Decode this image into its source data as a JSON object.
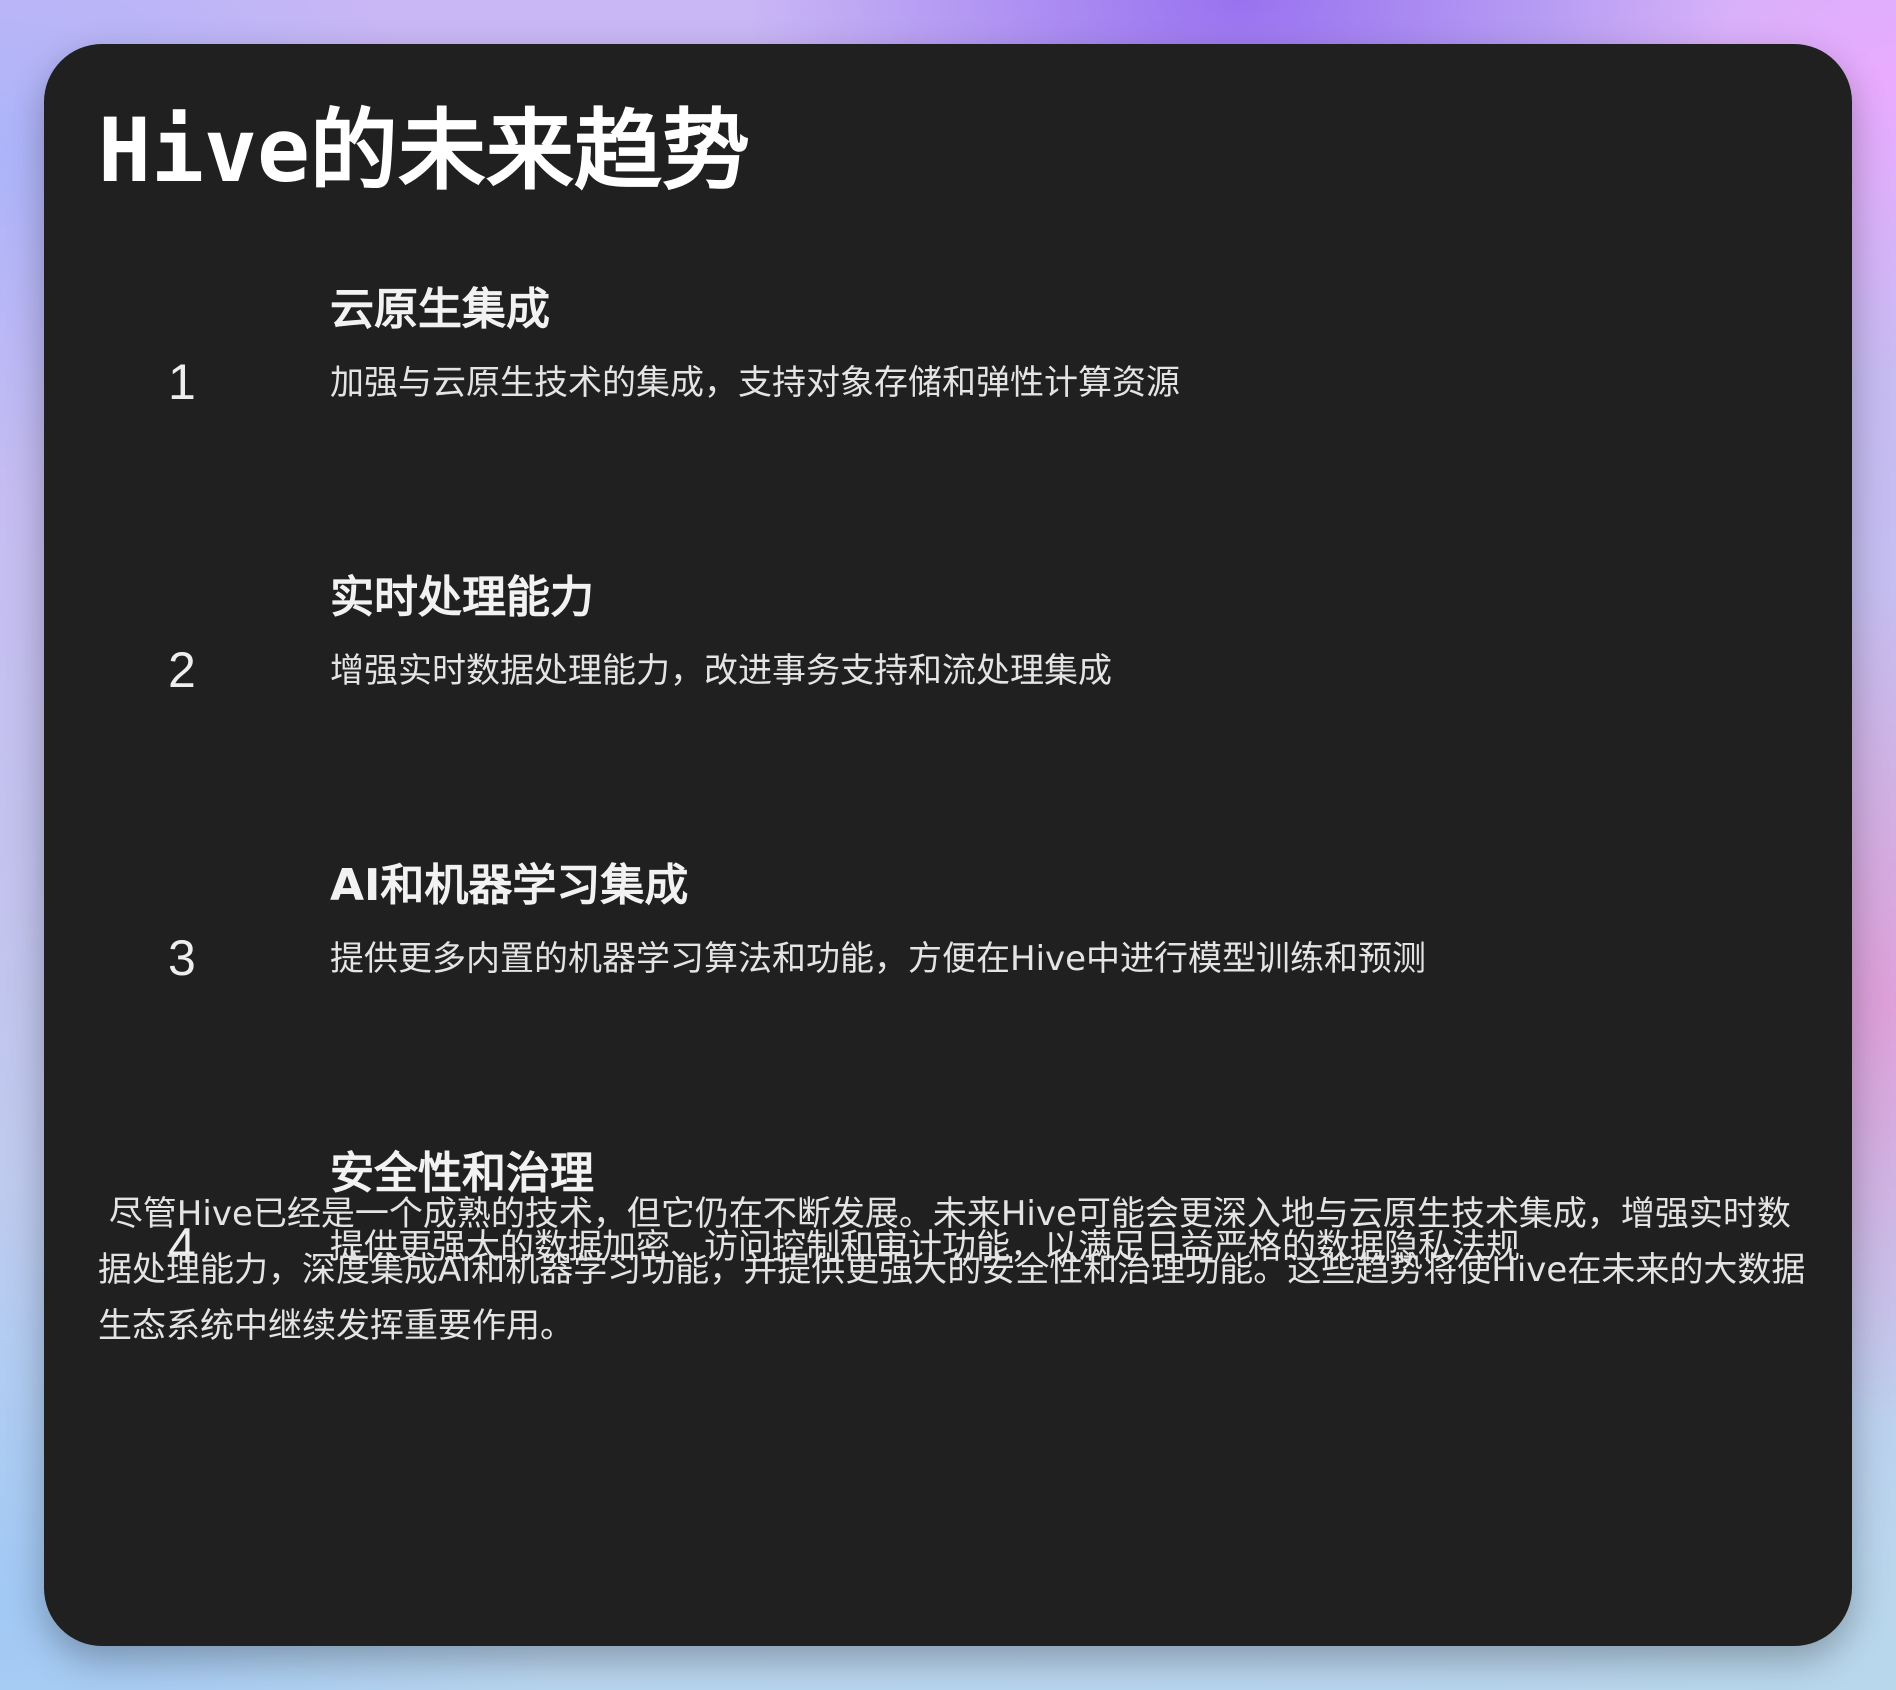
{
  "page": {
    "title": "Hive的未来趋势"
  },
  "trends": [
    {
      "number": "1",
      "title": "云原生集成",
      "description": "加强与云原生技术的集成，支持对象存储和弹性计算资源"
    },
    {
      "number": "2",
      "title": "实时处理能力",
      "description": "增强实时数据处理能力，改进事务支持和流处理集成"
    },
    {
      "number": "3",
      "title": "AI和机器学习集成",
      "description": "提供更多内置的机器学习算法和功能，方便在Hive中进行模型训练和预测"
    },
    {
      "number": "4",
      "title": "安全性和治理",
      "description": "提供更强大的数据加密、访问控制和审计功能，以满足日益严格的数据隐私法规"
    }
  ],
  "summary": {
    "text": " 尽管Hive已经是一个成熟的技术，但它仍在不断发展。未来Hive可能会更深入地与云原生技术集成，增强实时数据处理能力，深度集成AI和机器学习功能，并提供更强大的安全性和治理功能。这些趋势将使Hive在未来的大数据生态系统中继续发挥重要作用。"
  }
}
